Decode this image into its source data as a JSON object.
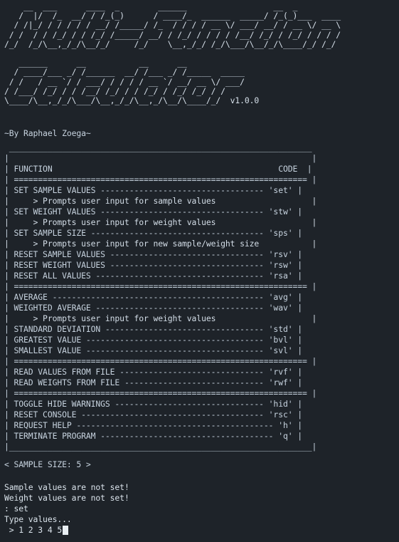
{
  "banner": {
    "ascii_art": [
      "    __  ___      ____  _        ______                  __  _",
      "   /  |/  /_  __/ / /_(_)      / ____/_  ______  _____/ /_(_)___  ____",
      "  / /|_/ / / / / / __/ /_____/ /_  / / / / __ \\/ ___/ __/ / __ \\/ __ \\",
      " / /  / / /_/ / / /_/ /_____/ __/ / /_/ / / / / /__/ /_/ / /_/ / / / /",
      "/_/  /_/\\__,_/_/\\__/_/     /_/    \\__,_/_/ /_/\\___/\\__/_/\\____/_/ /_/",
      "",
      "   ______      __           __      __",
      "  / ____/___ _/ /______  __/ /___ _/ /_____  _____",
      " / /   / __ `/ / ___/ / / / / __ `/ __/ __ \\/ ___/",
      "/ /___/ /_/ / / /__/ /_/ / / /_/ / /_/ /_/ / /",
      "\\____/\\__,_/_/\\___/\\__,_/_/\\__,_/\\__/\\____/_/  v1.0.0"
    ],
    "author": "~By Raphael Zoega~"
  },
  "menu": {
    "lines": [
      " _______________________________________________________________",
      "|                                                               |",
      "| FUNCTION                                               CODE  |",
      "| ============================================================= |",
      "| SET SAMPLE VALUES ---------------------------------- 'set' |",
      "|     > Prompts user input for sample values                    |",
      "| SET WEIGHT VALUES ---------------------------------- 'stw' |",
      "|     > Prompts user input for weight values                    |",
      "| SET SAMPLE SIZE ------------------------------------ 'sps' |",
      "|     > Prompts user input for new sample/weight size           |",
      "| RESET SAMPLE VALUES -------------------------------- 'rsv' |",
      "| RESET WEIGHT VALUES -------------------------------- 'rsw' |",
      "| RESET ALL VALUES ----------------------------------- 'rsa' |",
      "| ============================================================= |",
      "| AVERAGE -------------------------------------------- 'avg' |",
      "| WEIGHTED AVERAGE ----------------------------------- 'wav' |",
      "|     > Prompts user input for weight values                    |",
      "| STANDARD DEVIATION --------------------------------- 'std' |",
      "| GREATEST VALUE ------------------------------------- 'bvl' |",
      "| SMALLEST VALUE ------------------------------------- 'svl' |",
      "| ============================================================= |",
      "| READ VALUES FROM FILE ------------------------------ 'rvf' |",
      "| READ WEIGHTS FROM FILE ----------------------------- 'rwf' |",
      "| ============================================================= |",
      "| TOGGLE HIDE WARNINGS ------------------------------- 'hid' |",
      "| RESET CONSOLE -------------------------------------- 'rsc' |",
      "| REQUEST HELP ----------------------------------------- 'h' |",
      "| TERMINATE PROGRAM ------------------------------------ 'q' |",
      "|_______________________________________________________________|"
    ]
  },
  "status": {
    "sample_size": "< SAMPLE SIZE: 5 >"
  },
  "console": {
    "lines": [
      "Sample values are not set!",
      "Weight values are not set!",
      ": set",
      "Type values..."
    ],
    "input_line": " > 1 2 3 4 5"
  }
}
